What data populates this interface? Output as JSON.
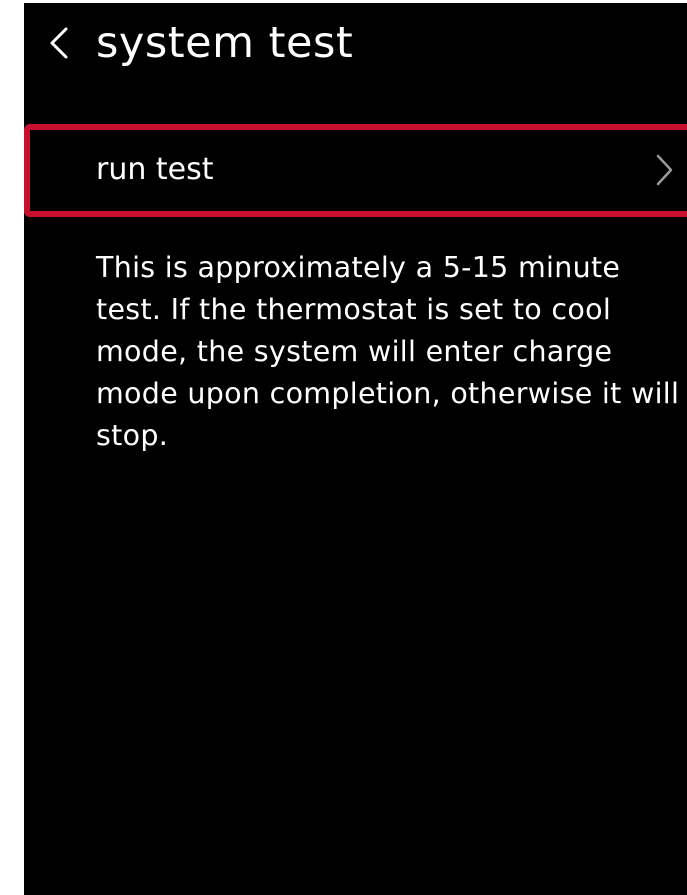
{
  "header": {
    "title": "system test"
  },
  "menu": {
    "run_test_label": "run test"
  },
  "description": "This is approximately a 5-15 minute test. If the thermostat is set to cool mode, the system will enter charge mode upon completion, otherwise it will stop.",
  "icons": {
    "back": "chevron-left-icon",
    "row_arrow": "chevron-right-icon"
  },
  "colors": {
    "background": "#000000",
    "text": "#ffffff",
    "highlight_border": "#c8102e",
    "chevron": "#9a9a9a"
  }
}
